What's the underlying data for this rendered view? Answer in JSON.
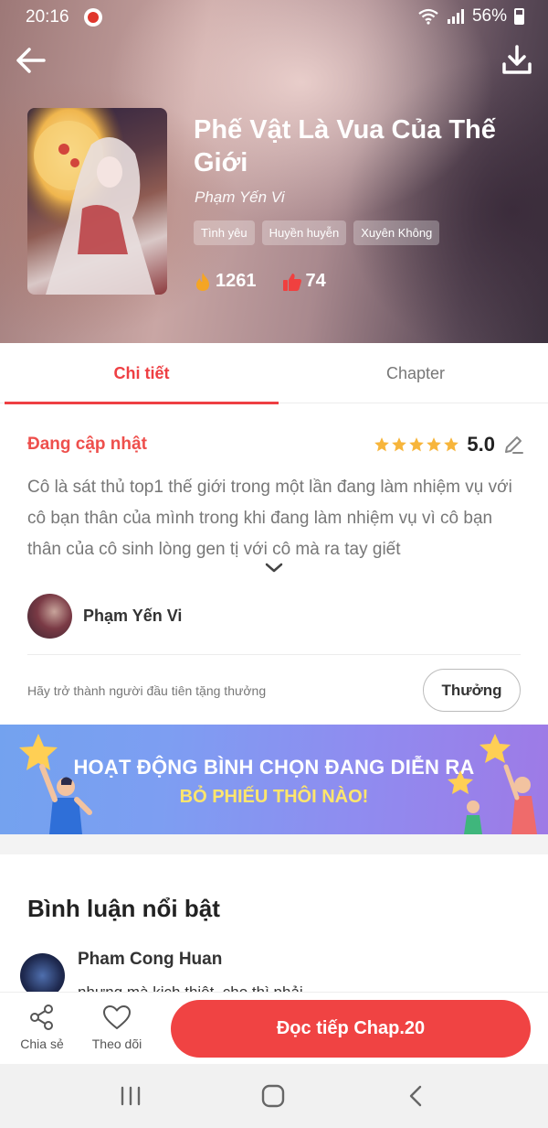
{
  "status_bar": {
    "time": "20:16",
    "battery": "56%"
  },
  "header": {
    "title": "Phế Vật Là Vua Của Thế Giới",
    "author": "Phạm Yến Vi",
    "tags": [
      "Tình yêu",
      "Huyền huyễn",
      "Xuyên Không"
    ],
    "stats": {
      "views": "1261",
      "likes": "74"
    },
    "icons": {
      "back": "arrow-left-icon",
      "download": "download-icon",
      "views": "fire-icon",
      "likes": "thumbs-up-icon"
    }
  },
  "tabs": [
    {
      "label": "Chi tiết",
      "active": true
    },
    {
      "label": "Chapter",
      "active": false
    }
  ],
  "detail": {
    "update_status": "Đang cập nhật",
    "rating": {
      "value": "5.0",
      "stars": 5
    },
    "description": "Cô là sát thủ top1 thế giới trong một lần đang làm nhiệm vụ với cô bạn thân của mình trong khi đang làm nhiệm vụ vì cô bạn thân của cô sinh lòng gen tị với cô mà ra tay giết",
    "author_name": "Phạm Yến Vi",
    "reward_prompt": "Hãy trở thành người đầu tiên tặng thưởng",
    "reward_button": "Thưởng"
  },
  "banner": {
    "title": "HOẠT ĐỘNG BÌNH CHỌN ĐANG DIỄN RA",
    "subtitle": "BỎ PHIẾU THÔI NÀO!"
  },
  "comments": {
    "title": "Bình luận nổi bật",
    "items": [
      {
        "user": "Pham Cong Huan",
        "text": "nhưng mà kịch thiệt, cho thì phải"
      }
    ]
  },
  "action_bar": {
    "share_label": "Chia sẻ",
    "follow_label": "Theo dõi",
    "continue_label": "Đọc tiếp Chap.20"
  },
  "colors": {
    "accent": "#ee3f43",
    "star": "#f7b53b",
    "banner_highlight": "#ffe66d"
  }
}
